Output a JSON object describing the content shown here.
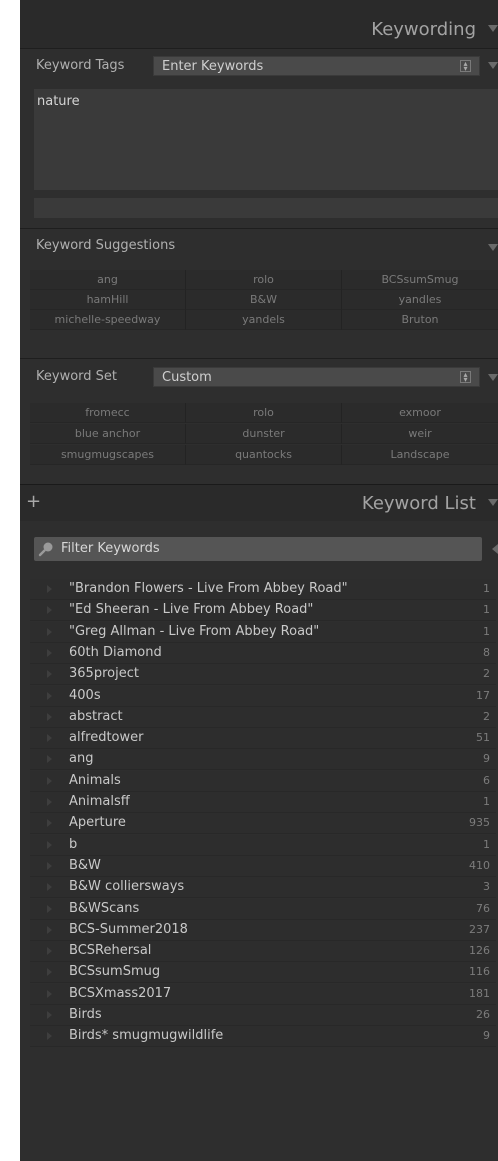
{
  "keywording": {
    "title": "Keywording",
    "tags_label": "Keyword Tags",
    "tags_mode": "Enter Keywords",
    "tags_text": "nature"
  },
  "suggestions": {
    "title": "Keyword Suggestions",
    "items": [
      "ang",
      "rolo",
      "BCSsumSmug",
      "hamHill",
      "B&W",
      "yandles",
      "michelle-speedway",
      "yandels",
      "Bruton"
    ]
  },
  "keyword_set": {
    "label": "Keyword Set",
    "value": "Custom",
    "items": [
      "fromecc",
      "rolo",
      "exmoor",
      "blue anchor",
      "dunster",
      "weir",
      "smugmugscapes",
      "quantocks",
      "Landscape"
    ]
  },
  "keyword_list": {
    "add": "+",
    "title": "Keyword List",
    "filter_placeholder": "Filter Keywords",
    "items": [
      {
        "name": "\"Brandon Flowers - Live From Abbey Road\"",
        "count": "1"
      },
      {
        "name": "\"Ed Sheeran - Live From Abbey Road\"",
        "count": "1"
      },
      {
        "name": "\"Greg Allman - Live From Abbey Road\"",
        "count": "1"
      },
      {
        "name": "60th Diamond",
        "count": "8"
      },
      {
        "name": "365project",
        "count": "2"
      },
      {
        "name": "400s",
        "count": "17"
      },
      {
        "name": "abstract",
        "count": "2"
      },
      {
        "name": "alfredtower",
        "count": "51"
      },
      {
        "name": "ang",
        "count": "9"
      },
      {
        "name": "Animals",
        "count": "6"
      },
      {
        "name": "Animalsff",
        "count": "1"
      },
      {
        "name": "Aperture",
        "count": "935"
      },
      {
        "name": "b",
        "count": "1"
      },
      {
        "name": "B&W",
        "count": "410"
      },
      {
        "name": "B&W colliersways",
        "count": "3"
      },
      {
        "name": "B&WScans",
        "count": "76"
      },
      {
        "name": "BCS-Summer2018",
        "count": "237"
      },
      {
        "name": "BCSRehersal",
        "count": "126"
      },
      {
        "name": "BCSsumSmug",
        "count": "116"
      },
      {
        "name": "BCSXmass2017",
        "count": "181"
      },
      {
        "name": "Birds",
        "count": "26"
      },
      {
        "name": "Birds* smugmugwildlife",
        "count": "9"
      }
    ]
  }
}
